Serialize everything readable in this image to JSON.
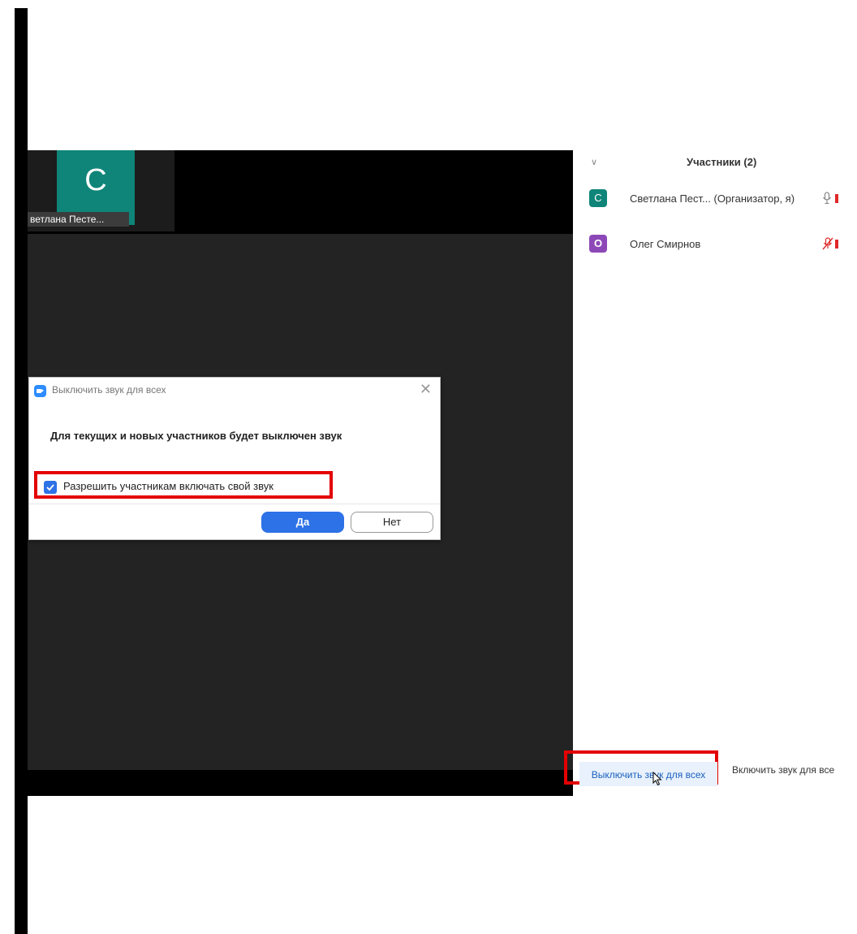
{
  "video": {
    "thumbnail_letter": "С",
    "thumbnail_name": "ветлана Песте..."
  },
  "participants": {
    "title": "Участники (2)",
    "items": [
      {
        "initial": "С",
        "name": "Светлана Пест... (Организатор, я)",
        "mic": "mic-on",
        "video": "video-off"
      },
      {
        "initial": "О",
        "name": "Олег Смирнов",
        "mic": "mic-muted",
        "video": "video-off"
      }
    ],
    "mute_all_label": "Выключить звук для всех",
    "unmute_all_label": "Включить звук для все"
  },
  "dialog": {
    "title": "Выключить звук для всех",
    "message": "Для текущих и новых участников будет выключен звук",
    "checkbox_label": "Разрешить участникам включать свой звук",
    "checkbox_checked": true,
    "yes_label": "Да",
    "no_label": "Нет"
  },
  "colors": {
    "accent": "#2d72e6",
    "highlight": "#e30000",
    "avatar_c": "#0e8578",
    "avatar_o": "#8d48b8"
  }
}
